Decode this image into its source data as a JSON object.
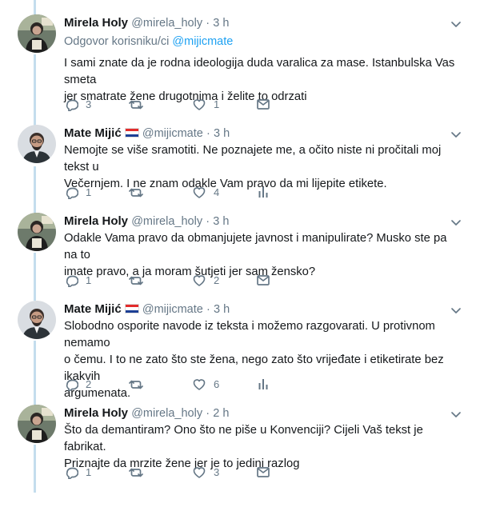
{
  "tweets": [
    {
      "name": "Mirela Holy",
      "handle": "@mirela_holy",
      "time": "3 h",
      "flag": false,
      "reply_prefix": "Odgovor korisniku/ci",
      "reply_mention": "@mijicmate",
      "text": [
        "I sami znate da je rodna ideologija duda varalica za mase. Istanbulska Vas smeta",
        "jer smatrate žene drugotnima i želite to odrzati"
      ],
      "replies": "3",
      "retweets": "",
      "likes": "1",
      "last_action": "mail-icon"
    },
    {
      "name": "Mate Mijić",
      "handle": "@mijicmate",
      "time": "3 h",
      "flag": true,
      "text": [
        "Nemojte se više sramotiti. Ne poznajete me, a očito niste ni pročitali moj tekst u",
        "Večernjem. I ne znam odakle Vam pravo da mi lijepite etikete."
      ],
      "replies": "1",
      "retweets": "",
      "likes": "4",
      "last_action": "analytics-icon"
    },
    {
      "name": "Mirela Holy",
      "handle": "@mirela_holy",
      "time": "3 h",
      "flag": false,
      "text": [
        "Odakle Vama pravo da obmanjujete javnost i manipulirate? Musko ste pa na to",
        "imate pravo, a ja moram šutjeti jer sam žensko?"
      ],
      "replies": "1",
      "retweets": "",
      "likes": "2",
      "last_action": "mail-icon"
    },
    {
      "name": "Mate Mijić",
      "handle": "@mijicmate",
      "time": "3 h",
      "flag": true,
      "text": [
        "Slobodno osporite navode iz teksta i možemo razgovarati. U protivnom nemamo",
        "o čemu. I to ne zato što ste žena, nego zato što vrijeđate i etiketirate bez ikakvih",
        "argumenata."
      ],
      "replies": "2",
      "retweets": "",
      "likes": "6",
      "last_action": "analytics-icon"
    },
    {
      "name": "Mirela Holy",
      "handle": "@mirela_holy",
      "time": "2 h",
      "flag": false,
      "text": [
        "Što da demantiram? Ono što ne piše u Konvenciji? Cijeli Vaš tekst je fabrikat.",
        "Priznajte da mrzite žene jer je to jedini razlog"
      ],
      "replies": "1",
      "retweets": "",
      "likes": "3",
      "last_action": "mail-icon"
    }
  ],
  "colors": {
    "thread_line": "#c4dded",
    "secondary_text": "#657786",
    "link": "#1da1f2",
    "icon": "#657786"
  }
}
